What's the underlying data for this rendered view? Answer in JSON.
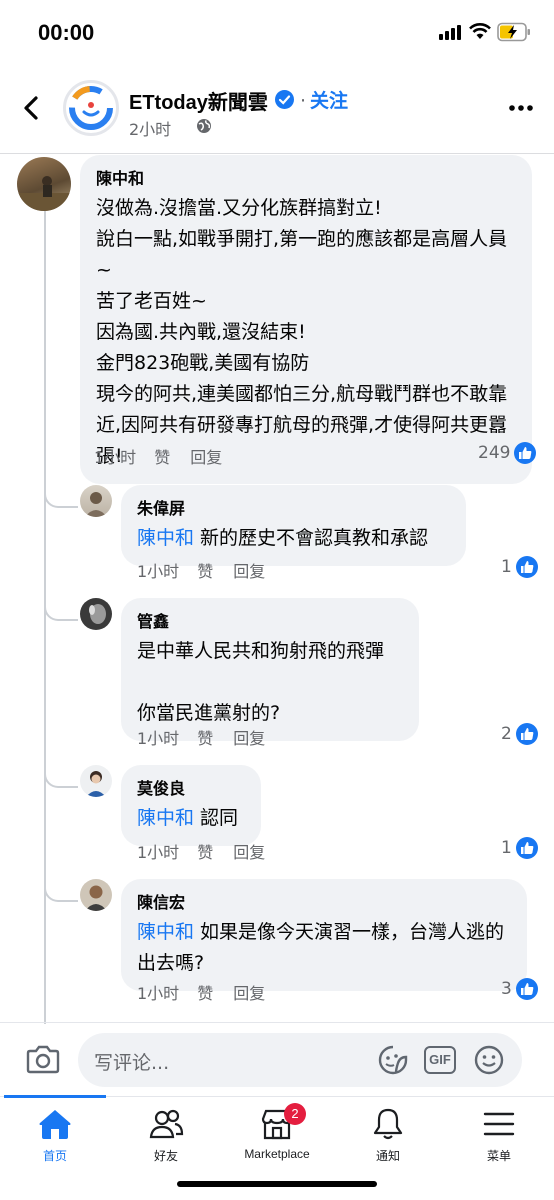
{
  "status_bar": {
    "time": "00:00"
  },
  "header": {
    "page_name": "ETtoday新聞雲",
    "follow_label": "关注",
    "separator": "·",
    "post_time": "2小时"
  },
  "comments": [
    {
      "author": "陳中和",
      "tag": "",
      "text": "沒做為.沒擔當.又分化族群搞對立!\n說白一點,如戰爭開打,第一跑的應該都是高層人員~\n苦了老百姓~\n因為國.共內戰,還沒結束!\n金門823砲戰,美國有協防\n現今的阿共,連美國都怕三分,航母戰鬥群也不敢靠近,因阿共有研發專打航母的飛彈,才使得阿共更囂張!",
      "time": "1小时",
      "like_label": "赞",
      "reply_label": "回复",
      "likes": "249"
    },
    {
      "author": "朱偉屏",
      "tag": "陳中和",
      "text": "新的歷史不會認真教和承認",
      "time": "1小时",
      "like_label": "赞",
      "reply_label": "回复",
      "likes": "1"
    },
    {
      "author": "管鑫",
      "tag": "",
      "text": "是中華人民共和狗射飛的飛彈\n\n你當民進黨射的?",
      "time": "1小时",
      "like_label": "赞",
      "reply_label": "回复",
      "likes": "2"
    },
    {
      "author": "莫俊良",
      "tag": "陳中和",
      "text": "認同",
      "time": "1小时",
      "like_label": "赞",
      "reply_label": "回复",
      "likes": "1"
    },
    {
      "author": "陳信宏",
      "tag": "陳中和",
      "text": "如果是像今天演習一樣，台灣人逃的出去嗎?",
      "time": "1小时",
      "like_label": "赞",
      "reply_label": "回复",
      "likes": "3"
    }
  ],
  "composer": {
    "placeholder": "写评论...",
    "gif_label": "GIF"
  },
  "tabs": [
    {
      "label": "首页",
      "icon": "home-icon",
      "active": true
    },
    {
      "label": "好友",
      "icon": "friends-icon"
    },
    {
      "label": "Marketplace",
      "icon": "marketplace-icon",
      "badge": "2"
    },
    {
      "label": "通知",
      "icon": "bell-icon"
    },
    {
      "label": "菜单",
      "icon": "menu-icon"
    }
  ],
  "colors": {
    "accent": "#1877f2",
    "bubble": "#f0f2f5",
    "badge": "#e41e3f",
    "secondary_text": "#65676b"
  }
}
